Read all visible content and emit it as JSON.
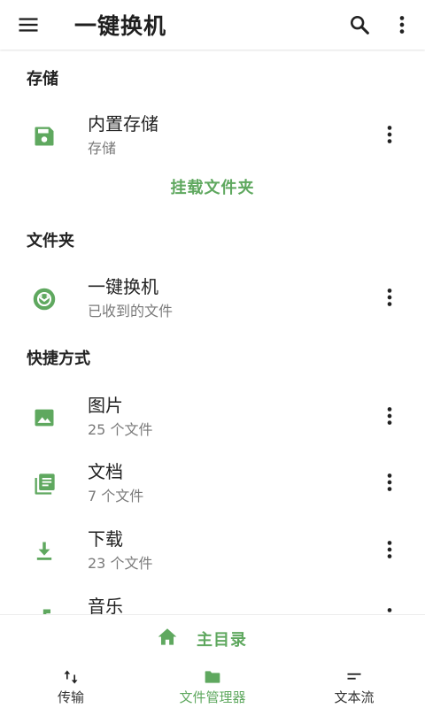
{
  "app_bar": {
    "title": "一键换机",
    "menu_icon": "menu-icon",
    "search_icon": "search-icon",
    "more_icon": "more-vert-icon"
  },
  "sections": {
    "storage": "存储",
    "folders": "文件夹",
    "shortcuts": "快捷方式"
  },
  "storage_items": [
    {
      "name": "内置存储",
      "subtitle": "存储",
      "icon": "save-icon"
    }
  ],
  "mount_action": "挂载文件夹",
  "folder_items": [
    {
      "name": "一键换机",
      "subtitle": "已收到的文件",
      "icon": "app-logo-icon"
    }
  ],
  "shortcut_items": [
    {
      "name": "图片",
      "subtitle": "25 个文件",
      "icon": "image-icon"
    },
    {
      "name": "文档",
      "subtitle": "7 个文件",
      "icon": "library-books-icon"
    },
    {
      "name": "下载",
      "subtitle": "23 个文件",
      "icon": "download-icon"
    },
    {
      "name": "音乐",
      "subtitle": "",
      "icon": "music-note-icon"
    }
  ],
  "home_button": {
    "label": "主目录",
    "icon": "home-icon"
  },
  "tabs": [
    {
      "label": "传输",
      "icon": "swap-vert-icon",
      "active": false
    },
    {
      "label": "文件管理器",
      "icon": "folder-icon",
      "active": true
    },
    {
      "label": "文本流",
      "icon": "short-text-icon",
      "active": false
    }
  ],
  "colors": {
    "accent": "#5fa85f",
    "text": "#222222",
    "subtext": "#7a7a7a"
  }
}
